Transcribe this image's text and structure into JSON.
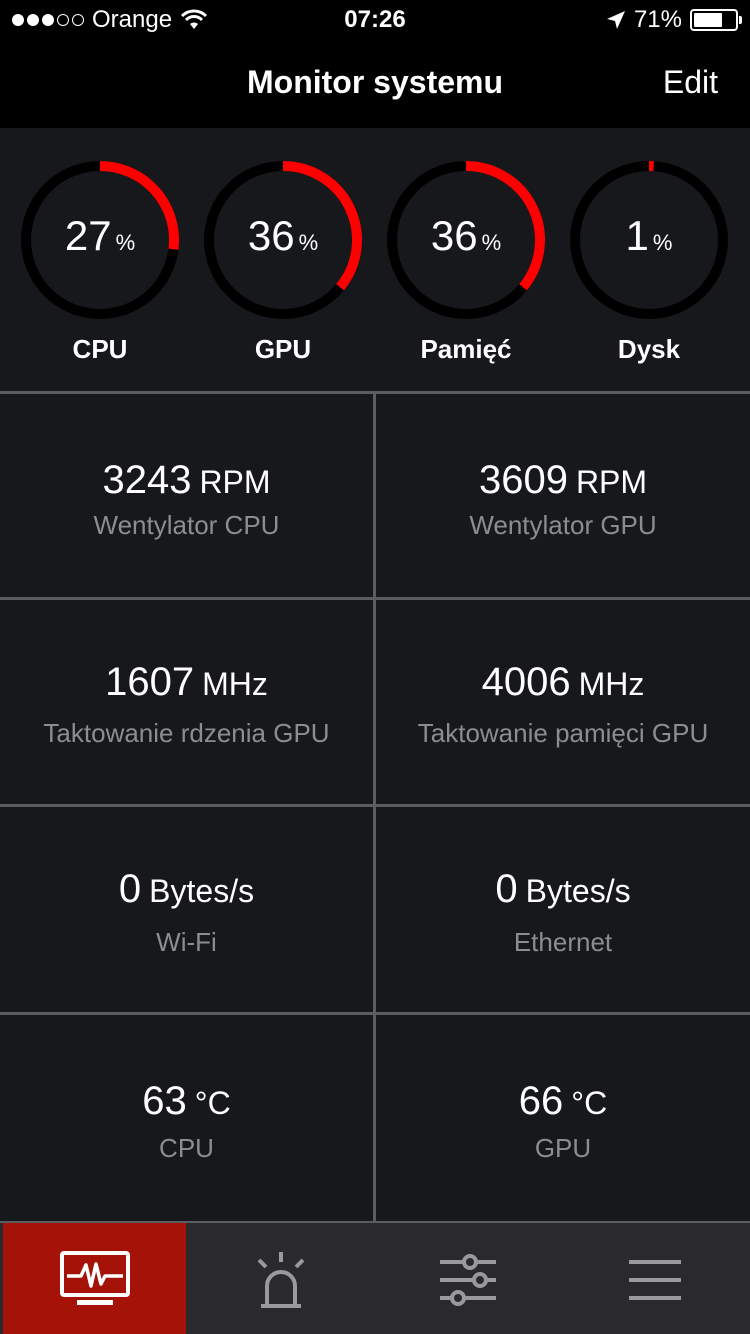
{
  "status_bar": {
    "carrier": "Orange",
    "time": "07:26",
    "battery": "71%",
    "signal_bars_filled": 3,
    "signal_bars_total": 5
  },
  "nav": {
    "title": "Monitor systemu",
    "edit_label": "Edit"
  },
  "gauges": [
    {
      "label": "CPU",
      "value": "27",
      "unit": "%",
      "fraction": 0.27
    },
    {
      "label": "GPU",
      "value": "36",
      "unit": "%",
      "fraction": 0.36
    },
    {
      "label": "Pamięć",
      "value": "36",
      "unit": "%",
      "fraction": 0.36
    },
    {
      "label": "Dysk",
      "value": "1",
      "unit": "%",
      "fraction": 0.01
    }
  ],
  "stats": [
    {
      "value": "3243",
      "unit": "RPM",
      "label": "Wentylator CPU"
    },
    {
      "value": "3609",
      "unit": "RPM",
      "label": "Wentylator GPU"
    },
    {
      "value": "1607",
      "unit": "MHz",
      "label": "Taktowanie rdzenia GPU"
    },
    {
      "value": "4006",
      "unit": "MHz",
      "label": "Taktowanie pamięci GPU"
    },
    {
      "value": "0",
      "unit": "Bytes/s",
      "label": "Wi-Fi"
    },
    {
      "value": "0",
      "unit": "Bytes/s",
      "label": "Ethernet"
    },
    {
      "value": "63",
      "unit": "°C",
      "label": "CPU"
    },
    {
      "value": "66",
      "unit": "°C",
      "label": "GPU"
    }
  ],
  "tabs": [
    {
      "icon": "monitor-icon",
      "active": true
    },
    {
      "icon": "alarm-icon",
      "active": false
    },
    {
      "icon": "sliders-icon",
      "active": false
    },
    {
      "icon": "menu-icon",
      "active": false
    }
  ],
  "colors": {
    "accent": "#ff0000",
    "active_tab": "#a51208",
    "panel": "#17181c",
    "divider": "#5c5d60",
    "label_gray": "#8c8d90"
  }
}
